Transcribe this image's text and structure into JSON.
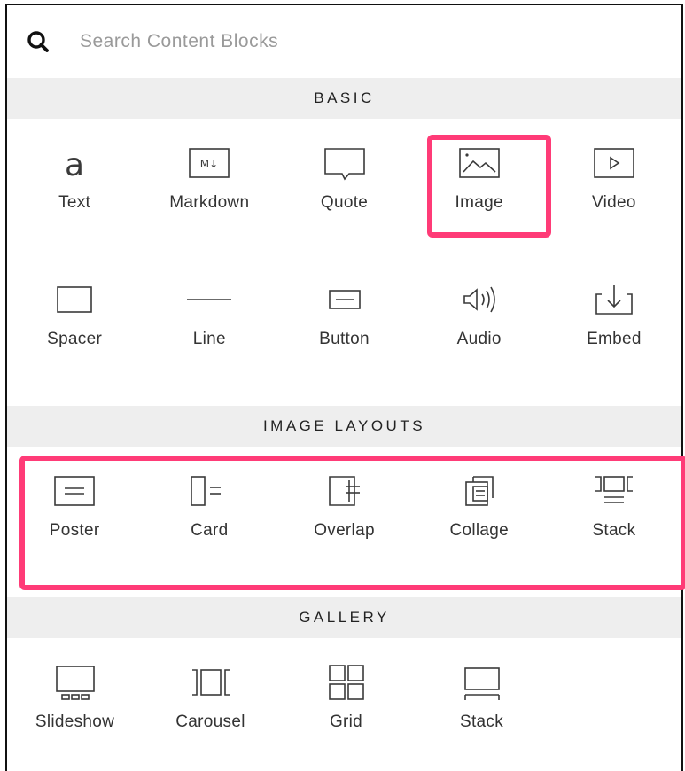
{
  "search": {
    "placeholder": "Search Content Blocks",
    "icon": "search-icon"
  },
  "sections": {
    "basic": {
      "title": "BASIC",
      "items": [
        {
          "label": "Text",
          "icon": "text-icon"
        },
        {
          "label": "Markdown",
          "icon": "markdown-icon"
        },
        {
          "label": "Quote",
          "icon": "quote-icon"
        },
        {
          "label": "Image",
          "icon": "image-icon"
        },
        {
          "label": "Video",
          "icon": "video-icon"
        },
        {
          "label": "Spacer",
          "icon": "spacer-icon"
        },
        {
          "label": "Line",
          "icon": "line-icon"
        },
        {
          "label": "Button",
          "icon": "button-icon"
        },
        {
          "label": "Audio",
          "icon": "audio-icon"
        },
        {
          "label": "Embed",
          "icon": "embed-icon"
        }
      ]
    },
    "image_layouts": {
      "title": "IMAGE LAYOUTS",
      "items": [
        {
          "label": "Poster",
          "icon": "poster-icon"
        },
        {
          "label": "Card",
          "icon": "card-icon"
        },
        {
          "label": "Overlap",
          "icon": "overlap-icon"
        },
        {
          "label": "Collage",
          "icon": "collage-icon"
        },
        {
          "label": "Stack",
          "icon": "stack-layout-icon"
        }
      ]
    },
    "gallery": {
      "title": "GALLERY",
      "items": [
        {
          "label": "Slideshow",
          "icon": "slideshow-icon"
        },
        {
          "label": "Carousel",
          "icon": "carousel-icon"
        },
        {
          "label": "Grid",
          "icon": "grid-icon"
        },
        {
          "label": "Stack",
          "icon": "stack-gallery-icon"
        }
      ]
    }
  },
  "colors": {
    "highlight": "#ff3b77",
    "section_bg": "#eeeeee"
  }
}
